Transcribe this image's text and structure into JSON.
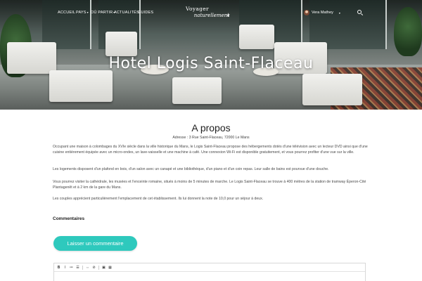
{
  "nav": {
    "items": [
      {
        "label": "ACCUEIL",
        "dropdown": false
      },
      {
        "label": "PAYS",
        "dropdown": true
      },
      {
        "label": "OÙ PARTIR",
        "dropdown": true
      },
      {
        "label": "ACTUALITÉS",
        "dropdown": false
      },
      {
        "label": "GUIDES",
        "dropdown": false
      }
    ],
    "caret": "▾",
    "logo_line1": "Voyager",
    "logo_line2": "naturellement",
    "user_name": "Vera   Mathey",
    "search_icon": "search-icon"
  },
  "hero": {
    "title": "Hotel  Logis Saint-Flaceau"
  },
  "about": {
    "title": "A propos",
    "address": "Adresse :  3 Rue Saint-Flaceau, 72000 Le Mans",
    "paragraphs": [
      "Occupant une maison à colombages du XVIe siècle dans la ville historique du Mans, le Logis Saint-Flaceau propose des hébergements dotés d'une télévision avec un lecteur DVD ainsi que d'une cuisine entièrement équipée avec un micro-ondes, un lave-vaisselle et une machine à café. Une connexion Wi-Fi est disponible gratuitement, et vous pourrez profiter d'une vue sur la ville.",
      "Les logements disposent d'un plafond en bois, d'un salon avec un canapé et une bibliothèque, d'un piano et d'un coin repas. Leur salle de bains est pourvue d'une douche.",
      "Vous pourrez visiter la cathédrale, les musées et l'enceinte romaine, situés à moins de 5 minutes de marche. Le Logis Saint-Flaceau se trouve à 400 mètres de la station de tramway Éperon-Cité Plantagenêt et à 2 km de la gare du Mans.",
      "Les couples apprécient particulièrement l'emplacement de cet établissement. Ils lui donnent la note de 10,0 pour un séjour à deux."
    ]
  },
  "comments": {
    "heading": "Commentaires",
    "button_label": "Laisser un commentaire",
    "toolbar": [
      "B",
      "I",
      "≔",
      "☰",
      "⇔",
      "⊘",
      "▣",
      "▦"
    ]
  },
  "colors": {
    "accent": "#2ec9bd"
  }
}
